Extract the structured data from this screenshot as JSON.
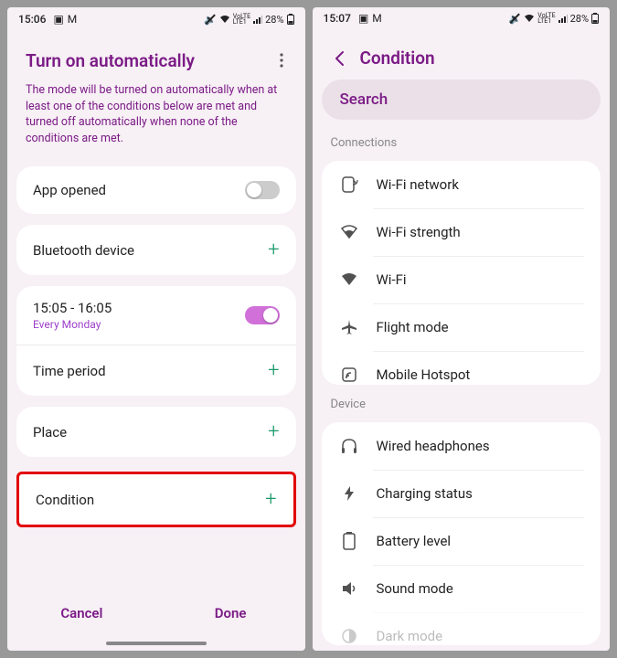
{
  "left": {
    "status": {
      "time": "15:06",
      "battery": "28%"
    },
    "title": "Turn on automatically",
    "description": "The mode will be turned on automatically when at least one of the conditions below are met and turned off automatically when none of the conditions are met.",
    "app_opened": "App opened",
    "bluetooth": "Bluetooth device",
    "time_range": "15:05 - 16:05",
    "time_recur": "Every Monday",
    "time_period": "Time period",
    "place": "Place",
    "condition": "Condition",
    "cancel": "Cancel",
    "done": "Done"
  },
  "right": {
    "status": {
      "time": "15:07",
      "battery": "28%"
    },
    "title": "Condition",
    "search": "Search",
    "section_connections": "Connections",
    "section_device": "Device",
    "conn": {
      "wifi_network": "Wi-Fi network",
      "wifi_strength": "Wi-Fi strength",
      "wifi": "Wi-Fi",
      "flight": "Flight mode",
      "hotspot": "Mobile Hotspot"
    },
    "dev": {
      "headphones": "Wired headphones",
      "charging": "Charging status",
      "battery": "Battery level",
      "sound": "Sound mode",
      "dark": "Dark mode"
    }
  }
}
